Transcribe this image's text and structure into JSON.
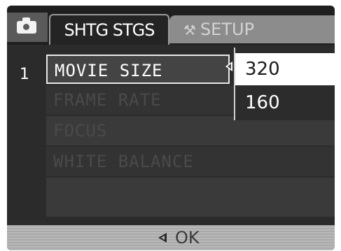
{
  "tabs": {
    "camera_icon": "camera-icon",
    "shooting": "SHTG STGS",
    "setup_icon": "tools-icon",
    "setup": "SETUP"
  },
  "menu": {
    "page": "1",
    "items": [
      "MOVIE SIZE",
      "FRAME RATE",
      "FOCUS",
      "WHITE BALANCE"
    ],
    "selected_index": 0
  },
  "dropdown": {
    "options": [
      "320",
      "160"
    ],
    "selected": "320"
  },
  "footer": {
    "back_icon": "left-triangle-icon",
    "ok_label": "OK"
  }
}
